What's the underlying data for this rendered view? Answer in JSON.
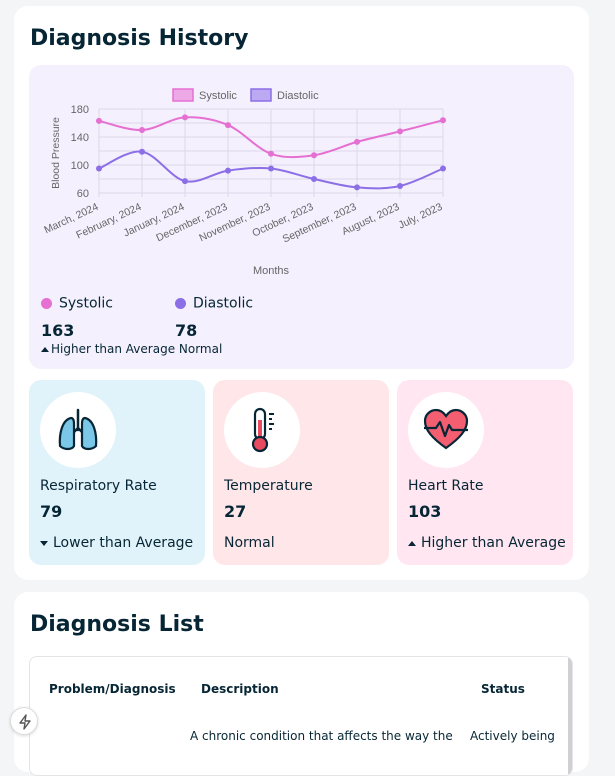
{
  "history": {
    "title": "Diagnosis History",
    "chart": {
      "ylabel": "Blood Pressure",
      "xlabel": "Months",
      "legend": [
        "Systolic",
        "Diastolic"
      ]
    },
    "systolic": {
      "label": "Systolic",
      "value": "163",
      "color": "#e66fd2"
    },
    "diastolic": {
      "label": "Diastolic",
      "value": "78",
      "color": "#8c6fe6"
    },
    "note": "Higher than Average Normal"
  },
  "chart_data": {
    "type": "line",
    "x": [
      "March, 2024",
      "February, 2024",
      "January, 2024",
      "December, 2023",
      "November, 2023",
      "October, 2023",
      "September, 2023",
      "August, 2023",
      "July, 2023"
    ],
    "series": [
      {
        "name": "Systolic",
        "values": [
          163,
          150,
          168,
          157,
          116,
          114,
          133,
          148,
          164
        ],
        "color": "#e66fd2"
      },
      {
        "name": "Diastolic",
        "values": [
          95,
          119,
          77,
          92,
          95,
          80,
          68,
          70,
          95
        ],
        "color": "#8c6fe6"
      }
    ],
    "xlabel": "Months",
    "ylabel": "Blood Pressure",
    "ylim": [
      60,
      180
    ],
    "yticks": [
      60,
      100,
      140,
      180
    ],
    "grid": true,
    "legend": "top"
  },
  "vitals": [
    {
      "icon": "lungs-icon",
      "label": "Respiratory Rate",
      "value": "79",
      "note": "Lower than Average",
      "trend": "down",
      "bg": "#e0f3fa"
    },
    {
      "icon": "thermometer-icon",
      "label": "Temperature",
      "value": "27",
      "note": "Normal",
      "trend": "none",
      "bg": "#ffe6e9"
    },
    {
      "icon": "heart-icon",
      "label": "Heart Rate",
      "value": "103",
      "note": "Higher than Average",
      "trend": "up",
      "bg": "#ffe6f1"
    }
  ],
  "list": {
    "title": "Diagnosis List",
    "headers": [
      "Problem/Diagnosis",
      "Description",
      "Status"
    ],
    "row": {
      "problem": "",
      "description": "A chronic condition that affects the way the",
      "status": "Actively being"
    }
  }
}
